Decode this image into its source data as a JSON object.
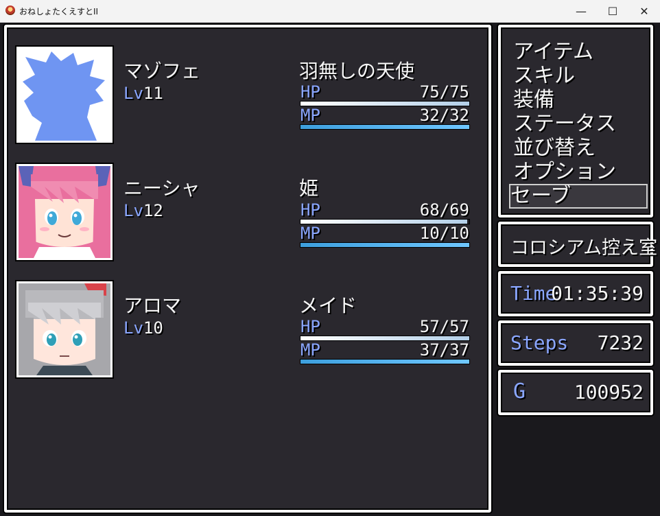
{
  "window": {
    "title": "おねしょたくえすとII"
  },
  "party": [
    {
      "name": "マゾフェ",
      "level_label": "Lv",
      "level": "11",
      "class": "羽無しの天使",
      "hp_label": "HP",
      "hp": "75/75",
      "hp_ratio": 1.0,
      "mp_label": "MP",
      "mp": "32/32",
      "mp_ratio": 1.0
    },
    {
      "name": "ニーシャ",
      "level_label": "Lv",
      "level": "12",
      "class": "姫",
      "hp_label": "HP",
      "hp": "68/69",
      "hp_ratio": 0.986,
      "mp_label": "MP",
      "mp": "10/10",
      "mp_ratio": 1.0
    },
    {
      "name": "アロマ",
      "level_label": "Lv",
      "level": "10",
      "class": "メイド",
      "hp_label": "HP",
      "hp": "57/57",
      "hp_ratio": 1.0,
      "mp_label": "MP",
      "mp": "37/37",
      "mp_ratio": 1.0
    }
  ],
  "menu": {
    "items": [
      "アイテム",
      "スキル",
      "装備",
      "ステータス",
      "並び替え",
      "オプション",
      "セーブ"
    ],
    "selected": 6
  },
  "location": "コロシアム控え室",
  "time": {
    "label": "Time",
    "value": "01:35:39"
  },
  "steps": {
    "label": "Steps",
    "value": "7232"
  },
  "gold": {
    "label": "G",
    "value": "100952"
  },
  "colors": {
    "system": "#8aa6ff",
    "window": "#2a282e",
    "hp_gauge": "#ffffff",
    "mp_gauge": "#3d9fdd"
  }
}
